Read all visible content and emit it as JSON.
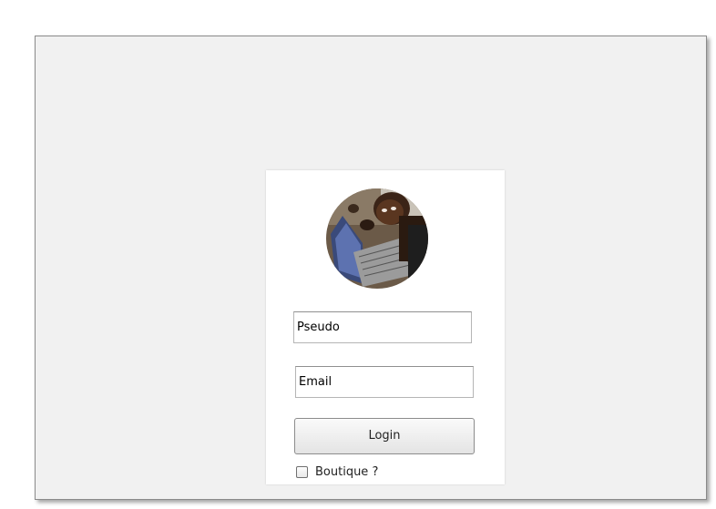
{
  "login_form": {
    "avatar_icon": "photo-avatar",
    "pseudo_placeholder": "Pseudo",
    "email_placeholder": "Email",
    "login_label": "Login",
    "boutique_label": "Boutique ?",
    "boutique_checked": false
  },
  "colors": {
    "background": "#f1f1f1",
    "card": "#ffffff",
    "frame_border": "#8a8a8a"
  }
}
